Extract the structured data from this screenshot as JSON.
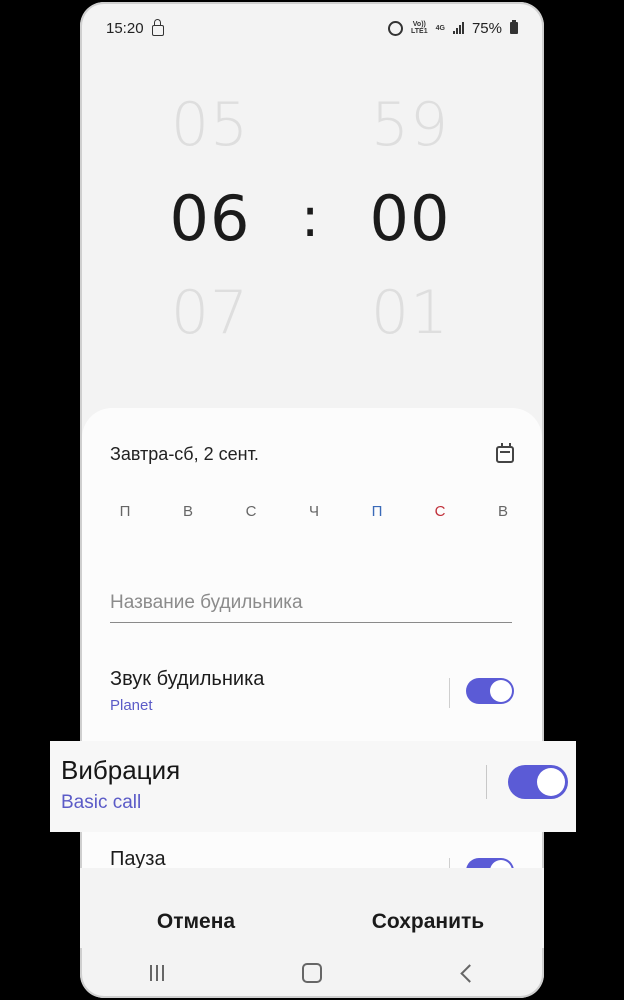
{
  "status_bar": {
    "time": "15:20",
    "network_top": "Vo))",
    "network_bottom": "LTE1",
    "network_type": "4G",
    "battery": "75%"
  },
  "time_picker": {
    "hour_prev": "05",
    "hour": "06",
    "hour_next": "07",
    "minute_prev": "59",
    "minute": "00",
    "minute_next": "01",
    "separator": ":"
  },
  "alarm": {
    "date_text": "Завтра-сб, 2 сент.",
    "weekdays": [
      "П",
      "В",
      "С",
      "Ч",
      "П",
      "С",
      "В"
    ],
    "name_placeholder": "Название будильника",
    "sound": {
      "title": "Звук будильника",
      "subtitle": "Planet",
      "enabled": true
    },
    "vibration": {
      "title": "Вибрация",
      "subtitle": "Basic call",
      "enabled": true
    },
    "pause": {
      "title": "Пауза",
      "enabled": true
    }
  },
  "actions": {
    "cancel": "Отмена",
    "save": "Сохранить"
  },
  "colors": {
    "accent": "#5b5bd6",
    "friday": "#3a6ab8",
    "saturday": "#c0303a"
  }
}
